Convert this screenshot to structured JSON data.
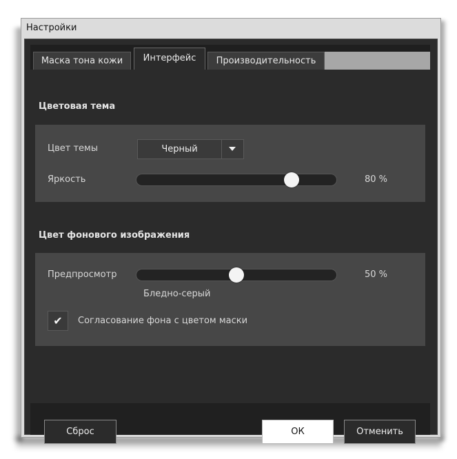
{
  "window": {
    "title": "Настройки"
  },
  "tabs": [
    {
      "label": "Маска тона кожи",
      "active": false
    },
    {
      "label": "Интерфейс",
      "active": true
    },
    {
      "label": "Производительность",
      "active": false
    }
  ],
  "theme_section": {
    "title": "Цветовая тема",
    "theme_color_label": "Цвет темы",
    "theme_color_value": "Черный",
    "brightness_label": "Яркость",
    "brightness_value": 80,
    "brightness_display": "80 %"
  },
  "background_section": {
    "title": "Цвет фонового изображения",
    "preview_label": "Предпросмотр",
    "preview_value": 50,
    "preview_display": "50 %",
    "preview_caption": "Бледно-серый",
    "match_mask_label": "Согласование фона с цветом маски",
    "match_mask_checked": true,
    "check_glyph": "✔"
  },
  "buttons": {
    "reset": "Сброс",
    "ok": "ОК",
    "cancel": "Отменить"
  },
  "colors": {
    "frame_bg": "#2b2b2b",
    "panel_bg": "#474747",
    "accent_thumb": "#f4f4f4"
  }
}
